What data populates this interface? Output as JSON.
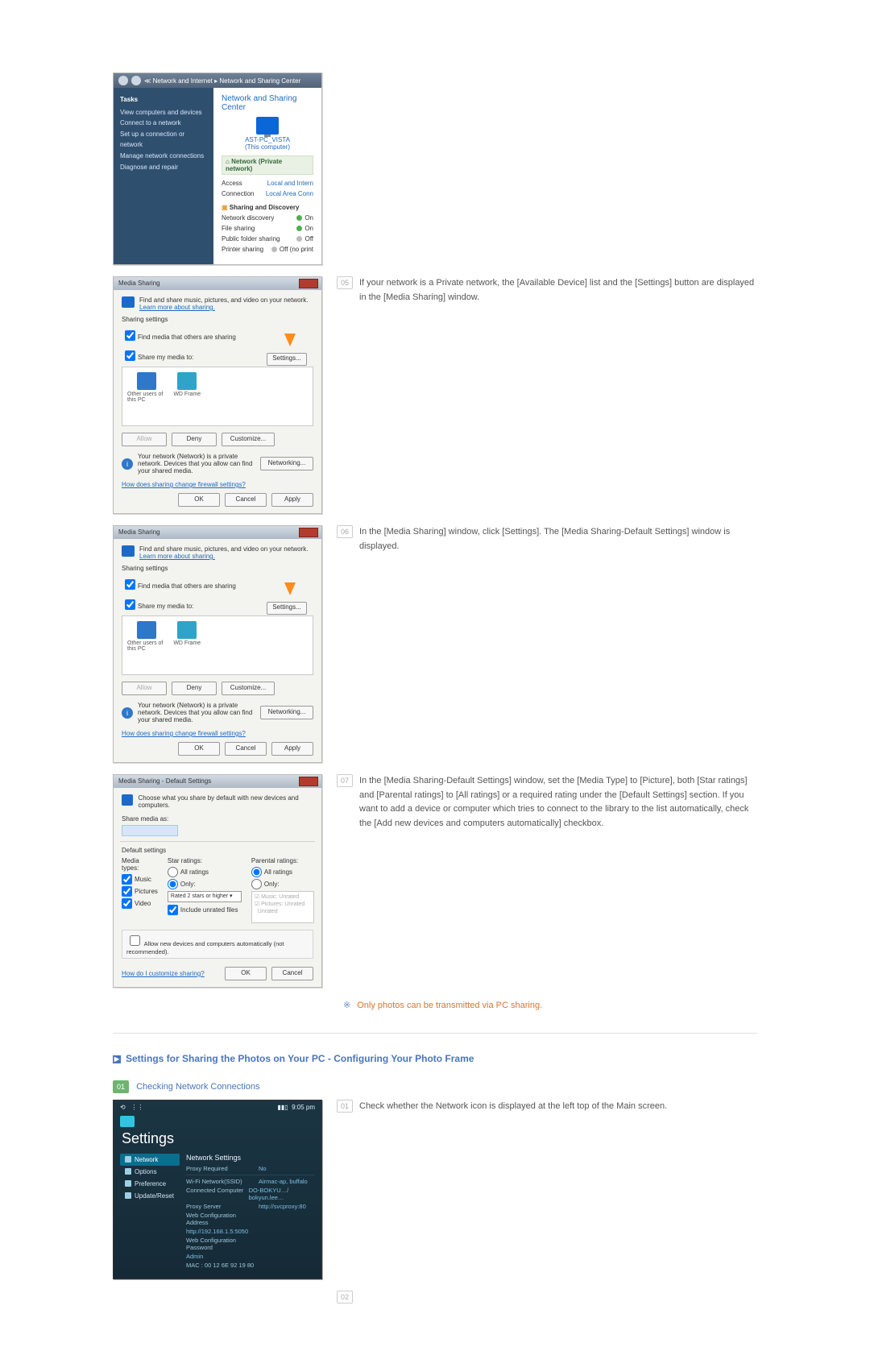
{
  "shot1": {
    "crumb": "≪  Network and Internet  ▸  Network and Sharing Center",
    "tasksTitle": "Tasks",
    "tasks": [
      "View computers and devices",
      "Connect to a network",
      "Set up a connection or network",
      "Manage network connections",
      "Diagnose and repair"
    ],
    "heading": "Network and Sharing Center",
    "pcName": "AST-PC_VISTA",
    "pcSub": "(This computer)",
    "band": "Network (Private network)",
    "rows1": [
      {
        "l": "Access",
        "r": "Local and Intern"
      },
      {
        "l": "Connection",
        "r": "Local Area Conn"
      }
    ],
    "subHead": "Sharing and Discovery",
    "rows2": [
      {
        "l": "Network discovery",
        "r": "On",
        "dot": "g"
      },
      {
        "l": "File sharing",
        "r": "On",
        "dot": "g"
      },
      {
        "l": "Public folder sharing",
        "r": "Off",
        "dot": "grey"
      },
      {
        "l": "Printer sharing",
        "r": "Off (no print",
        "dot": "grey"
      }
    ]
  },
  "ms": {
    "title": "Media Sharing",
    "line1": "Find and share music, pictures, and video on your network.",
    "learn": "Learn more about sharing.",
    "ssHead": "Sharing settings",
    "chk1": "Find media that others are sharing",
    "chk2": "Share my media to:",
    "dev1": "Other users of this PC",
    "dev2": "WD Frame",
    "settings": "Settings...",
    "allow": "Allow",
    "deny": "Deny",
    "customize": "Customize...",
    "note": "Your network (Network) is a private network. Devices that you allow can find your shared media.",
    "networking": "Networking...",
    "firewall": "How does sharing change firewall settings?",
    "ok": "OK",
    "cancel": "Cancel",
    "apply": "Apply"
  },
  "ds": {
    "title": "Media Sharing - Default Settings",
    "line1": "Choose what you share by default with new devices and computers.",
    "shareAs": "Share media as:",
    "defHead": "Default settings",
    "col1h": "Media types:",
    "col1": [
      "Music",
      "Pictures",
      "Video"
    ],
    "col2h": "Star ratings:",
    "col2a": "All ratings",
    "col2b": "Only:",
    "select": "Rated 2 stars or higher",
    "include": "Include unrated files",
    "col3h": "Parental ratings:",
    "col3a": "All ratings",
    "col3b": "Only:",
    "r1": "Music: Unrated",
    "r2": "Pictures: Unrated",
    "r3": "Unrated",
    "auto": "Allow new devices and computers automatically (not recommended).",
    "how": "How do I customize sharing?",
    "ok": "OK",
    "cancel": "Cancel"
  },
  "steps": {
    "s5n": "05",
    "s5": "If your network is a Private network, the [Available Device] list and the [Settings] button are displayed in the [Media Sharing] window.",
    "s6n": "06",
    "s6": "In the [Media Sharing] window, click [Settings]. The [Media Sharing-Default Settings] window is displayed.",
    "s7n": "07",
    "s7": "In the [Media Sharing-Default Settings] window, set the [Media Type] to [Picture], both [Star ratings] and [Parental ratings] to [All ratings] or a required rating under the [Default Settings] section. If you want to add a device or computer which tries to connect to the library to the list automatically, check the [Add new devices and computers automatically] checkbox.",
    "noteSym": "※",
    "note": "Only photos can be transmitted via PC sharing."
  },
  "sec2": {
    "bullet": "▶",
    "title": "Settings for Sharing the Photos on Your PC - Configuring Your Photo Frame",
    "sub1n": "01",
    "sub1": "Checking Network Connections",
    "t1n": "01",
    "t1": "Check whether the Network icon is displayed at the left top of the Main screen.",
    "t2n": "02"
  },
  "frame": {
    "time": "9:05 pm",
    "title": "Settings",
    "menu": [
      "Network",
      "Options",
      "Preference",
      "Update/Reset"
    ],
    "panelHead": "Network Settings",
    "rows": [
      {
        "k": "Proxy Required",
        "v": "No"
      },
      {
        "k": "Wi-Fi Network(SSID)",
        "v": "Airmac-ap, buffalo"
      },
      {
        "k": "Connected Computer",
        "v": "DO-BOKYU…/ bokyun.lee…"
      },
      {
        "k": "Proxy Server",
        "v": "http://svcproxy:80"
      },
      {
        "k": "Web Configuration Address",
        "v": ""
      },
      {
        "k": "    http://192.168.1.5:5050",
        "v": ""
      },
      {
        "k": "Web Configuration Password",
        "v": ""
      },
      {
        "k": "    Admin",
        "v": ""
      },
      {
        "k": "MAC : 00 12 6E 92 19 80",
        "v": ""
      }
    ]
  }
}
